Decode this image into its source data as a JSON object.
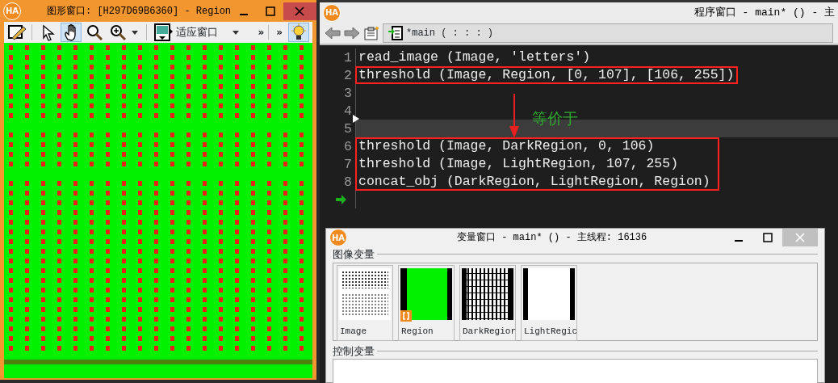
{
  "graphics_window": {
    "logo": "HA",
    "title": "图形窗口: [H297D69B6360] - Region",
    "view_tools": [
      {
        "selected": false
      },
      {
        "selected": true
      },
      {
        "selected": false
      },
      {
        "selected": false
      }
    ],
    "fit_button": {
      "label": "适应窗口"
    },
    "overflow_chevrons": [
      "»",
      "»"
    ],
    "help_toggle": {
      "on": true
    },
    "content": {
      "kind": "picture"
    }
  },
  "program_window": {
    "logo": "HA",
    "title": "程序窗口 - main* () - 主",
    "procedure_tab": {
      "label": "*main ( : : : )"
    },
    "code_blocks": [
      {
        "boxed": false,
        "lines": [
          {
            "number": "1",
            "text": "read_image (Image, 'letters')",
            "selected": false,
            "program_counter": false
          }
        ]
      },
      {
        "boxed": true,
        "lines": [
          {
            "number": "2",
            "text": "threshold (Image, Region, [0, 107], [106, 255])",
            "selected": false,
            "program_counter": false
          }
        ]
      },
      {
        "boxed": false,
        "lines": [
          {
            "number": "3",
            "selected": false,
            "program_counter": false
          },
          {
            "number": "4",
            "selected": false,
            "program_counter": false
          },
          {
            "number": "5",
            "selected": true,
            "program_counter": false
          }
        ]
      },
      {
        "boxed": true,
        "lines": [
          {
            "number": "6",
            "text": "threshold (Image, DarkRegion, 0, 106)",
            "selected": false,
            "program_counter": false
          },
          {
            "number": "7",
            "text": "threshold (Image, LightRegion, 107, 255)",
            "selected": false,
            "program_counter": false
          },
          {
            "number": "8",
            "text": "concat_obj (DarkRegion, LightRegion, Region)",
            "selected": false,
            "program_counter": false
          }
        ]
      },
      {
        "boxed": false,
        "lines": [
          {
            "selected": false,
            "program_counter": true
          }
        ]
      }
    ],
    "annotation": {
      "label": "等价于"
    }
  },
  "variable_window": {
    "logo": "HA",
    "title": "变量窗口 - main* () - 主线程: 16136",
    "image_group": {
      "label": "图像变量",
      "variables": [
        {
          "name": "Image",
          "kind": "picture",
          "tuple_badge": false
        },
        {
          "name": "Region",
          "kind": "picture",
          "tuple_badge": true
        },
        {
          "name": "DarkRegior",
          "kind": "picture",
          "tuple_badge": false
        },
        {
          "name": "LightRegic",
          "kind": "picture",
          "tuple_badge": false
        }
      ]
    },
    "control_group": {
      "label": "控制变量"
    }
  }
}
